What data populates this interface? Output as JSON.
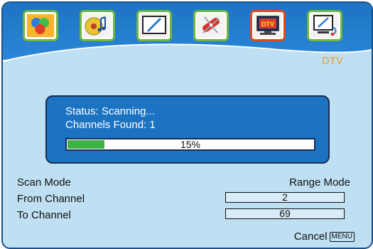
{
  "header": {
    "section_label": "DTV",
    "tabs": [
      {
        "icon": "picture-icon"
      },
      {
        "icon": "audio-icon"
      },
      {
        "icon": "screen-icon"
      },
      {
        "icon": "tools-icon"
      },
      {
        "icon": "dtv-icon",
        "text": "DTV"
      },
      {
        "icon": "pc-icon"
      }
    ]
  },
  "scan_status": {
    "status_line": "Status: Scanning...",
    "channels_line": "Channels Found: 1",
    "progress_value": 0.15,
    "progress_text": "15%"
  },
  "settings": {
    "scan_mode_label": "Scan Mode",
    "scan_mode_value": "Range Mode",
    "from_label": "From Channel",
    "from_value": "2",
    "to_label": "To Channel",
    "to_value": "69"
  },
  "footer": {
    "cancel_label": "Cancel",
    "menu_key": "MENU"
  },
  "colors": {
    "accent": "#f7941d",
    "progress": "#3fb245",
    "panel": "#1c73c2",
    "background": "#bfe0f2",
    "active_tab_border": "#e04a1b",
    "tab_border": "#6fb640"
  }
}
